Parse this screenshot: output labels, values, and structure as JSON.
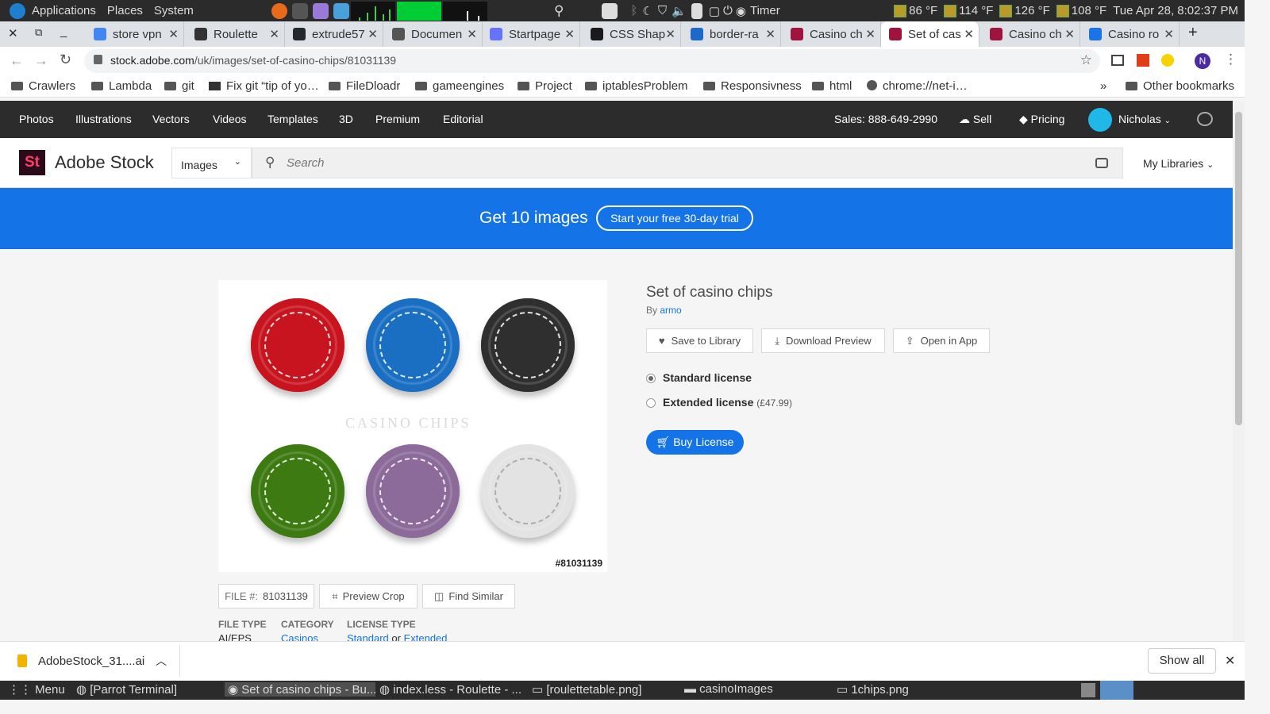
{
  "os": {
    "menus": [
      "Applications",
      "Places",
      "System"
    ],
    "timer_label": "Timer",
    "temps": [
      "86 °F",
      "114 °F",
      "126 °F",
      "108 °F"
    ],
    "clock": "Tue Apr 28,  8:02:37 PM"
  },
  "browser": {
    "tabs": [
      {
        "title": "store vpn",
        "color": "#4285f4"
      },
      {
        "title": "Roulette",
        "color": "#333333"
      },
      {
        "title": "extrude57",
        "color": "#24292e"
      },
      {
        "title": "Documen",
        "color": "#555555"
      },
      {
        "title": "Startpage",
        "color": "#6573ff"
      },
      {
        "title": "CSS Shap",
        "color": "#1a1a1a"
      },
      {
        "title": "border-ra",
        "color": "#1b6ac9"
      },
      {
        "title": "Casino ch",
        "color": "#a0133e"
      },
      {
        "title": "Set of cas",
        "color": "#a0133e"
      },
      {
        "title": "Casino ch",
        "color": "#a0133e"
      },
      {
        "title": "Casino ro",
        "color": "#1a73e8"
      }
    ],
    "url_host": "stock.adobe.com",
    "url_path": "/uk/images/set-of-casino-chips/81031139",
    "profile_initial": "N",
    "bookmarks": [
      "Crawlers",
      "Lambda",
      "git",
      "Fix git “tip of yo…",
      "FileDloadr",
      "gameengines",
      "Project",
      "iptablesProblem",
      "Responsivness",
      "html",
      "chrome://net-i…"
    ],
    "more": "»",
    "other_bookmarks": "Other bookmarks"
  },
  "adobe": {
    "nav": [
      "Photos",
      "Illustrations",
      "Vectors",
      "Videos",
      "Templates",
      "3D",
      "Premium",
      "Editorial"
    ],
    "sales": "Sales: 888-649-2990",
    "sell": "Sell",
    "pricing": "Pricing",
    "user": "Nicholas",
    "logo_mark": "St",
    "brand": "Adobe Stock",
    "search_type": "Images",
    "search_placeholder": "Search",
    "my_libraries": "My Libraries",
    "promo": "Get 10 images",
    "trial": "Start your free 30-day trial"
  },
  "asset": {
    "title": "Set of casino chips",
    "by": "By",
    "author": "armo",
    "image_id": "#81031139",
    "watermark": "CASINO CHIPS",
    "save": "Save to Library",
    "download": "Download Preview",
    "open_app": "Open in App",
    "standard": "Standard license",
    "extended": "Extended license",
    "extended_price": "(£47.99)",
    "buy": "Buy License",
    "file_label": "FILE #:",
    "file_num": "81031139",
    "preview_crop": "Preview Crop",
    "find_similar": "Find Similar",
    "file_type_h": "FILE TYPE",
    "file_type": "AI/EPS",
    "category_h": "CATEGORY",
    "category": "Casinos",
    "license_h": "LICENSE TYPE",
    "license_std": "Standard",
    "license_or": "or",
    "license_ext": "Extended",
    "chip_colors": [
      "#c8141f",
      "#1b6fc2",
      "#2f2f2f",
      "#3e7a12",
      "#8c6a99",
      "#e3e3e3"
    ]
  },
  "downloads": {
    "file": "AdobeStock_31....ai",
    "show_all": "Show all"
  },
  "taskbar": {
    "menu": "Menu",
    "items": [
      "[Parrot Terminal]",
      "Set of casino chips - Bu...",
      "index.less - Roulette - ...",
      "[roulettetable.png]",
      "casinoImages",
      "1chips.png"
    ]
  }
}
